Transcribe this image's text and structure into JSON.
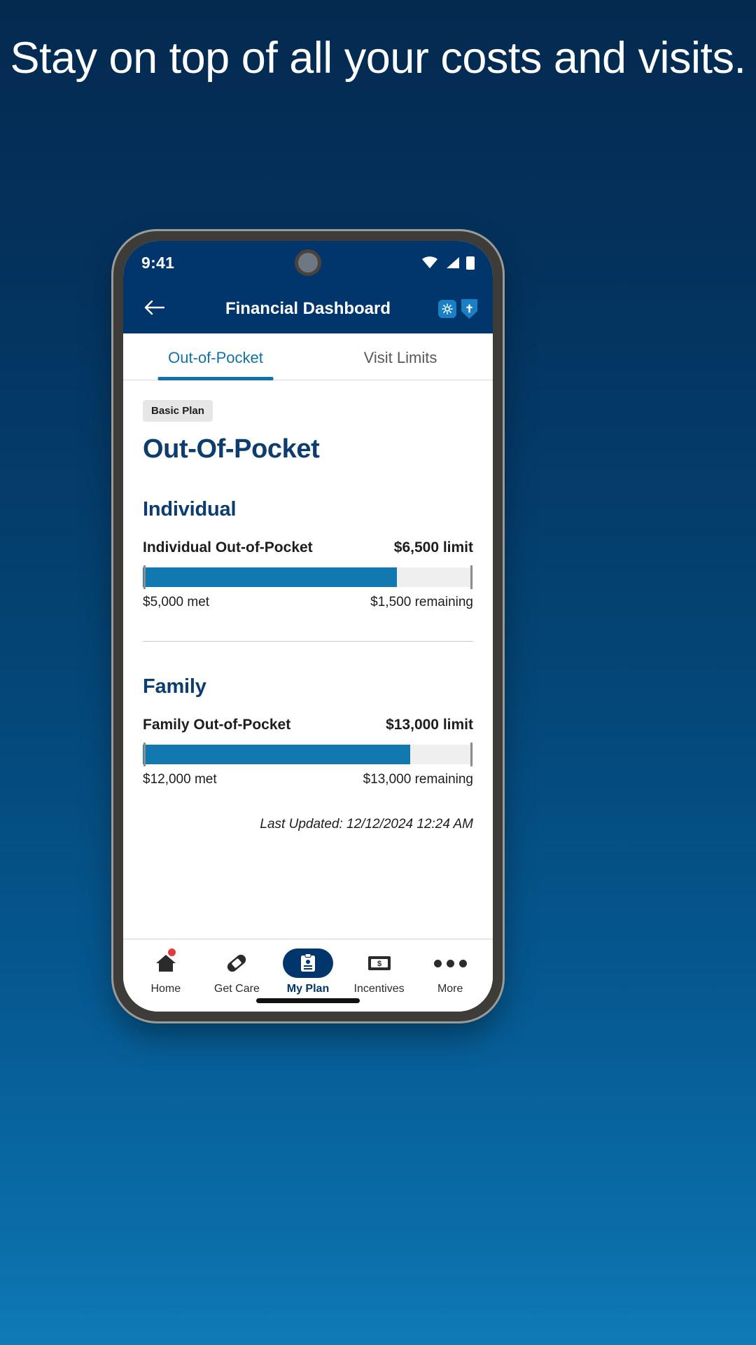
{
  "headline": "Stay on top of all your costs and visits.",
  "status_bar": {
    "time": "9:41",
    "icons": [
      "wifi-icon",
      "cellular-signal-icon",
      "battery-icon"
    ]
  },
  "app_bar": {
    "back_icon": "arrow-left-icon",
    "title": "Financial Dashboard",
    "gear_icon": "gear-icon",
    "brand_icon": "shield-logo-icon"
  },
  "tabs": [
    {
      "label": "Out-of-Pocket",
      "active": true
    },
    {
      "label": "Visit Limits",
      "active": false
    }
  ],
  "main": {
    "plan_badge": "Basic Plan",
    "page_title": "Out-Of-Pocket",
    "sections": [
      {
        "heading": "Individual",
        "row_label": "Individual Out-of-Pocket",
        "limit": "$6,500 limit",
        "met": "$5,000 met",
        "remaining": "$1,500 remaining",
        "percent": 77
      },
      {
        "heading": "Family",
        "row_label": "Family Out-of-Pocket",
        "limit": "$13,000 limit",
        "met": "$12,000 met",
        "remaining": "$13,000 remaining",
        "percent": 81
      }
    ],
    "last_updated": "Last Updated: 12/12/2024 12:24 AM"
  },
  "bottom_nav": [
    {
      "label": "Home",
      "icon": "house-icon",
      "active": false,
      "badge": true
    },
    {
      "label": "Get Care",
      "icon": "bandage-icon",
      "active": false,
      "badge": false
    },
    {
      "label": "My Plan",
      "icon": "id-card-icon",
      "active": true,
      "badge": false
    },
    {
      "label": "Incentives",
      "icon": "money-bill-icon",
      "active": false,
      "badge": false
    },
    {
      "label": "More",
      "icon": "ellipsis-icon",
      "active": false,
      "badge": false
    }
  ],
  "colors": {
    "background_navy": "#04335f",
    "header_navy": "#00366b",
    "accent_blue": "#1272a8",
    "progress_blue": "#1279b0",
    "title_navy": "#0d3c6e"
  }
}
